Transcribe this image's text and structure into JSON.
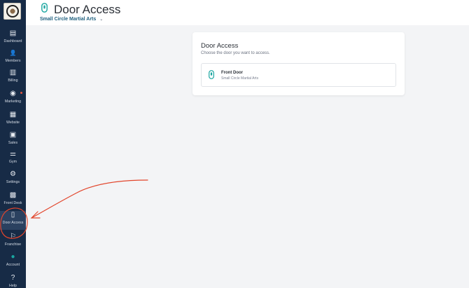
{
  "sidebar": {
    "items": [
      {
        "label": "Dashboard",
        "icon": "dashboard-icon",
        "glyph": "▤"
      },
      {
        "label": "Members",
        "icon": "members-icon",
        "glyph": "👤"
      },
      {
        "label": "Billing",
        "icon": "billing-icon",
        "glyph": "▥"
      },
      {
        "label": "Marketing",
        "icon": "marketing-icon",
        "glyph": "◉"
      },
      {
        "label": "Website",
        "icon": "website-icon",
        "glyph": "▦"
      },
      {
        "label": "Sales",
        "icon": "sales-icon",
        "glyph": "▣"
      },
      {
        "label": "Gym",
        "icon": "gym-icon",
        "glyph": "⚌"
      },
      {
        "label": "Settings",
        "icon": "settings-icon",
        "glyph": "⚙"
      },
      {
        "label": "Front Desk",
        "icon": "front-desk-icon",
        "glyph": "▩"
      },
      {
        "label": "Door Access",
        "icon": "door-access-icon",
        "glyph": "▯"
      },
      {
        "label": "Franchise",
        "icon": "franchise-icon",
        "glyph": "⚐"
      },
      {
        "label": "Account",
        "icon": "account-icon",
        "glyph": "●"
      },
      {
        "label": "Help",
        "icon": "help-icon",
        "glyph": "?"
      }
    ]
  },
  "header": {
    "title": "Door Access",
    "location": "Small Circle Martial Arts"
  },
  "card": {
    "title": "Door Access",
    "subtitle": "Choose the door you want to access.",
    "doors": [
      {
        "name": "Front Door",
        "location": "Small Circle Martial Arts"
      }
    ]
  },
  "colors": {
    "sidebar": "#172b46",
    "accent": "#1aa6a0",
    "annotation": "#e2452b"
  }
}
